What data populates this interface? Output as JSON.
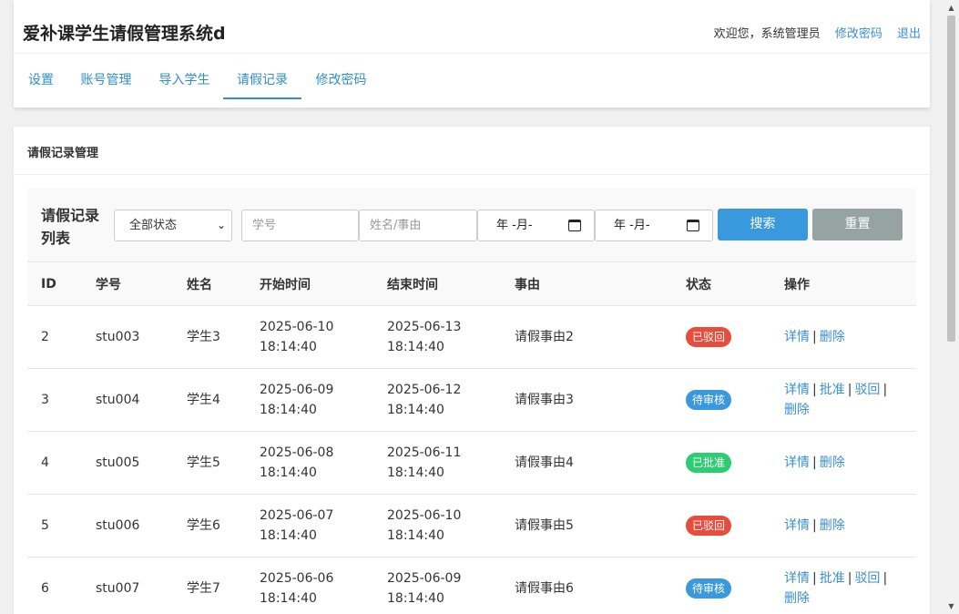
{
  "header": {
    "title": "爱补课学生请假管理系统d",
    "welcome": "欢迎您，系统管理员",
    "change_password": "修改密码",
    "logout": "退出"
  },
  "nav": {
    "items": [
      {
        "label": "设置"
      },
      {
        "label": "账号管理"
      },
      {
        "label": "导入学生"
      },
      {
        "label": "请假记录"
      },
      {
        "label": "修改密码"
      }
    ],
    "active": "请假记录"
  },
  "main": {
    "card_title": "请假记录管理",
    "list_title": "请假记录列表",
    "filters": {
      "status_selected": "全部状态",
      "student_no_placeholder": "学号",
      "name_reason_placeholder": "姓名/事由",
      "date_start_display": "年 -月-",
      "date_end_display": "年 -月-",
      "search_label": "搜索",
      "reset_label": "重置"
    },
    "table": {
      "headers": [
        "ID",
        "学号",
        "姓名",
        "开始时间",
        "结束时间",
        "事由",
        "状态",
        "操作"
      ],
      "rows": [
        {
          "id": "2",
          "student_no": "stu003",
          "name": "学生3",
          "start_date": "2025-06-10",
          "start_time": "18:14:40",
          "end_date": "2025-06-13",
          "end_time": "18:14:40",
          "reason": "请假事由2",
          "status": "已驳回",
          "status_color": "#e74c3c",
          "ops_line1": [
            "详情",
            "删除"
          ],
          "ops_line2": []
        },
        {
          "id": "3",
          "student_no": "stu004",
          "name": "学生4",
          "start_date": "2025-06-09",
          "start_time": "18:14:40",
          "end_date": "2025-06-12",
          "end_time": "18:14:40",
          "reason": "请假事由3",
          "status": "待审核",
          "status_color": "#3a98dc",
          "ops_line1": [
            "详情",
            "批准",
            "驳回"
          ],
          "ops_line2": [
            "删除"
          ]
        },
        {
          "id": "4",
          "student_no": "stu005",
          "name": "学生5",
          "start_date": "2025-06-08",
          "start_time": "18:14:40",
          "end_date": "2025-06-11",
          "end_time": "18:14:40",
          "reason": "请假事由4",
          "status": "已批准",
          "status_color": "#2ecc71",
          "ops_line1": [
            "详情",
            "删除"
          ],
          "ops_line2": []
        },
        {
          "id": "5",
          "student_no": "stu006",
          "name": "学生6",
          "start_date": "2025-06-07",
          "start_time": "18:14:40",
          "end_date": "2025-06-10",
          "end_time": "18:14:40",
          "reason": "请假事由5",
          "status": "已驳回",
          "status_color": "#e74c3c",
          "ops_line1": [
            "详情",
            "删除"
          ],
          "ops_line2": []
        },
        {
          "id": "6",
          "student_no": "stu007",
          "name": "学生7",
          "start_date": "2025-06-06",
          "start_time": "18:14:40",
          "end_date": "2025-06-09",
          "end_time": "18:14:40",
          "reason": "请假事由6",
          "status": "待审核",
          "status_color": "#3a98dc",
          "ops_line1": [
            "详情",
            "批准",
            "驳回"
          ],
          "ops_line2": [
            "删除"
          ]
        }
      ]
    }
  },
  "icons": {
    "select_chevron": "chevron-down-icon",
    "date_picker": "calendar-icon",
    "scroll_up": "scroll-up-arrow-icon",
    "scroll_down": "scroll-down-arrow-icon"
  },
  "colors": {
    "link": "#3a8fd0",
    "search_button": "#3a98dc",
    "reset_button": "#97a3a3"
  }
}
